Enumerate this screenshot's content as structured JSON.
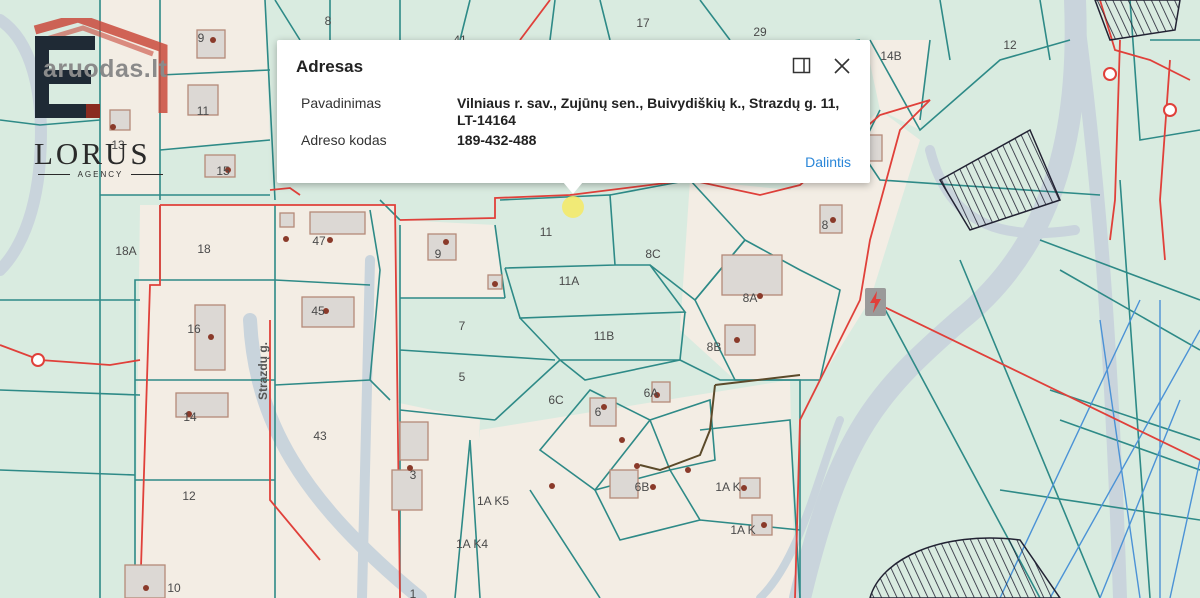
{
  "map": {
    "parcels": [
      {
        "number": "8"
      },
      {
        "number": "9"
      },
      {
        "number": "41"
      },
      {
        "number": "17"
      },
      {
        "number": "29"
      },
      {
        "number": "14B"
      },
      {
        "number": "12"
      },
      {
        "number": "11"
      },
      {
        "number": "13"
      },
      {
        "number": "15"
      },
      {
        "number": "18A"
      },
      {
        "number": "18"
      },
      {
        "number": "47"
      },
      {
        "number": "9"
      },
      {
        "number": "11"
      },
      {
        "number": "8C"
      },
      {
        "number": "8"
      },
      {
        "number": "11A"
      },
      {
        "number": "8A"
      },
      {
        "number": "16"
      },
      {
        "number": "45"
      },
      {
        "number": "7"
      },
      {
        "number": "11B"
      },
      {
        "number": "8B"
      },
      {
        "number": "5"
      },
      {
        "number": "6C"
      },
      {
        "number": "6A"
      },
      {
        "number": "6"
      },
      {
        "number": "14"
      },
      {
        "number": "43"
      },
      {
        "number": "3"
      },
      {
        "number": "12"
      },
      {
        "number": "1A K5"
      },
      {
        "number": "6B"
      },
      {
        "number": "1A K"
      },
      {
        "number": "1A K"
      },
      {
        "number": "1A K4"
      },
      {
        "number": "10"
      },
      {
        "number": "1"
      }
    ],
    "street_name": "Strazdų g."
  },
  "watermark": {
    "site": "aruodas.lt",
    "brand": "LORUS",
    "tagline": "AGENCY"
  },
  "popup": {
    "title": "Adresas",
    "rows": [
      {
        "label": "Pavadinimas",
        "value": "Vilniaus r. sav., Zujūnų sen., Buivydiškių k., Strazdų g. 11, LT-14164"
      },
      {
        "label": "Adreso kodas",
        "value": "189-432-488"
      }
    ],
    "share_label": "Dalintis",
    "icons": {
      "dock": "dock-panel-icon",
      "close": "close-icon"
    }
  },
  "colors": {
    "land": "#d9ebe0",
    "parcel_line": "#2e8a87",
    "road": "#f3ede4",
    "boundary": "#e0403a",
    "link": "#2a86d8"
  }
}
